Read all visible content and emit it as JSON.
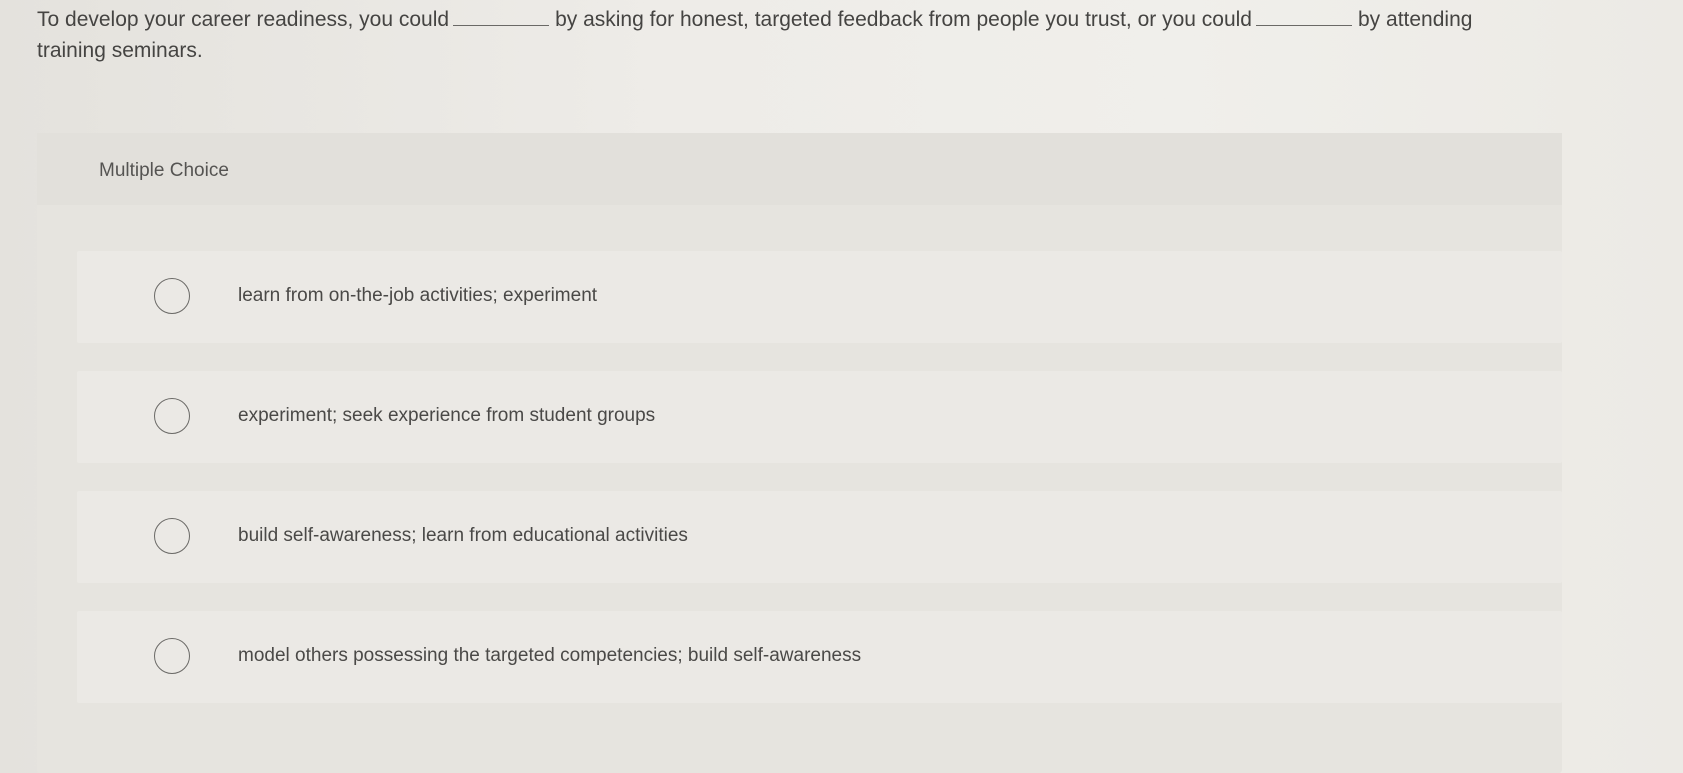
{
  "question": {
    "part1": "To develop your career readiness, you could",
    "part2": "by asking for honest, targeted feedback from people you trust, or you could",
    "part3": "by attending training seminars."
  },
  "panel": {
    "label": "Multiple Choice"
  },
  "options": [
    {
      "label": "learn from on-the-job activities; experiment",
      "selected": false
    },
    {
      "label": "experiment; seek experience from student groups",
      "selected": false
    },
    {
      "label": "build self-awareness; learn from educational activities",
      "selected": false
    },
    {
      "label": "model others possessing the targeted competencies; build self-awareness",
      "selected": false
    }
  ],
  "icons": {
    "radio": "radio-empty-icon"
  }
}
